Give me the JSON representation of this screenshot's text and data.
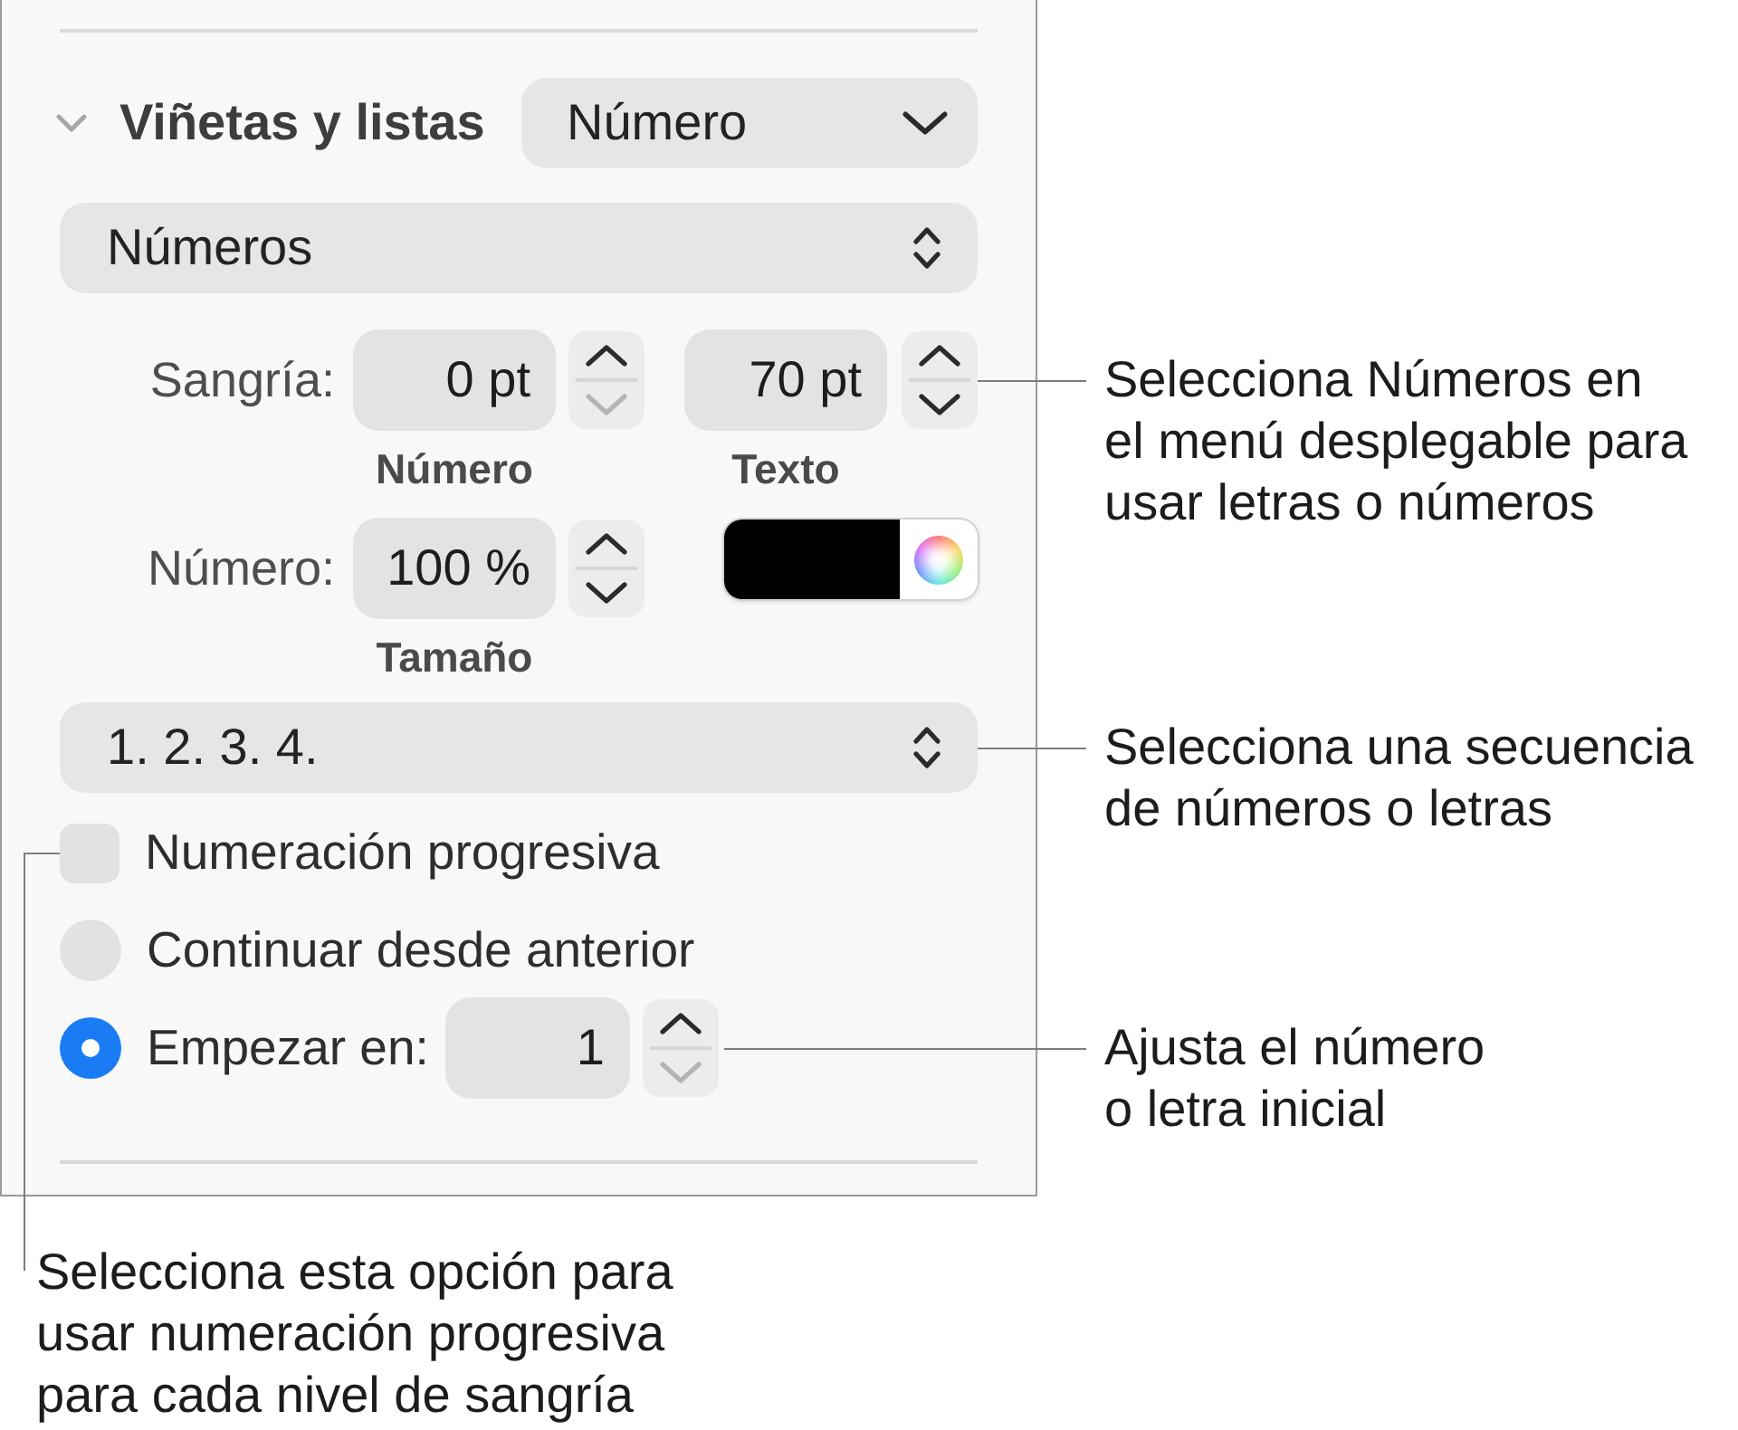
{
  "panel": {
    "section": {
      "title": "Viñetas y listas",
      "expanded": true,
      "style_popup": "Número"
    },
    "list_type": "Números",
    "indent": {
      "label": "Sangría:",
      "fields": [
        {
          "value": "0 pt",
          "caption": "Número",
          "down_disabled": true
        },
        {
          "value": "70 pt",
          "caption": "Texto",
          "down_disabled": false
        }
      ]
    },
    "number_size": {
      "label": "Número:",
      "value": "100 %",
      "caption": "Tamaño",
      "down_disabled": false,
      "color": "#000000"
    },
    "sequence": "1. 2. 3. 4.",
    "options": [
      {
        "kind": "checkbox",
        "label": "Numeración progresiva",
        "checked": false
      },
      {
        "kind": "radio",
        "label": "Continuar desde anterior",
        "selected": false
      },
      {
        "kind": "radio",
        "label": "Empezar en:",
        "selected": true,
        "value": "1",
        "down_disabled": true
      }
    ]
  },
  "callouts": [
    {
      "text": "Selecciona Números en\nel menú desplegable para\nusar letras o números"
    },
    {
      "text": "Selecciona una secuencia\nde números o letras"
    },
    {
      "text": "Ajusta el número\no letra inicial"
    },
    {
      "text": "Selecciona esta opción para\nusar numeración progresiva\npara cada nivel de sangría"
    }
  ]
}
